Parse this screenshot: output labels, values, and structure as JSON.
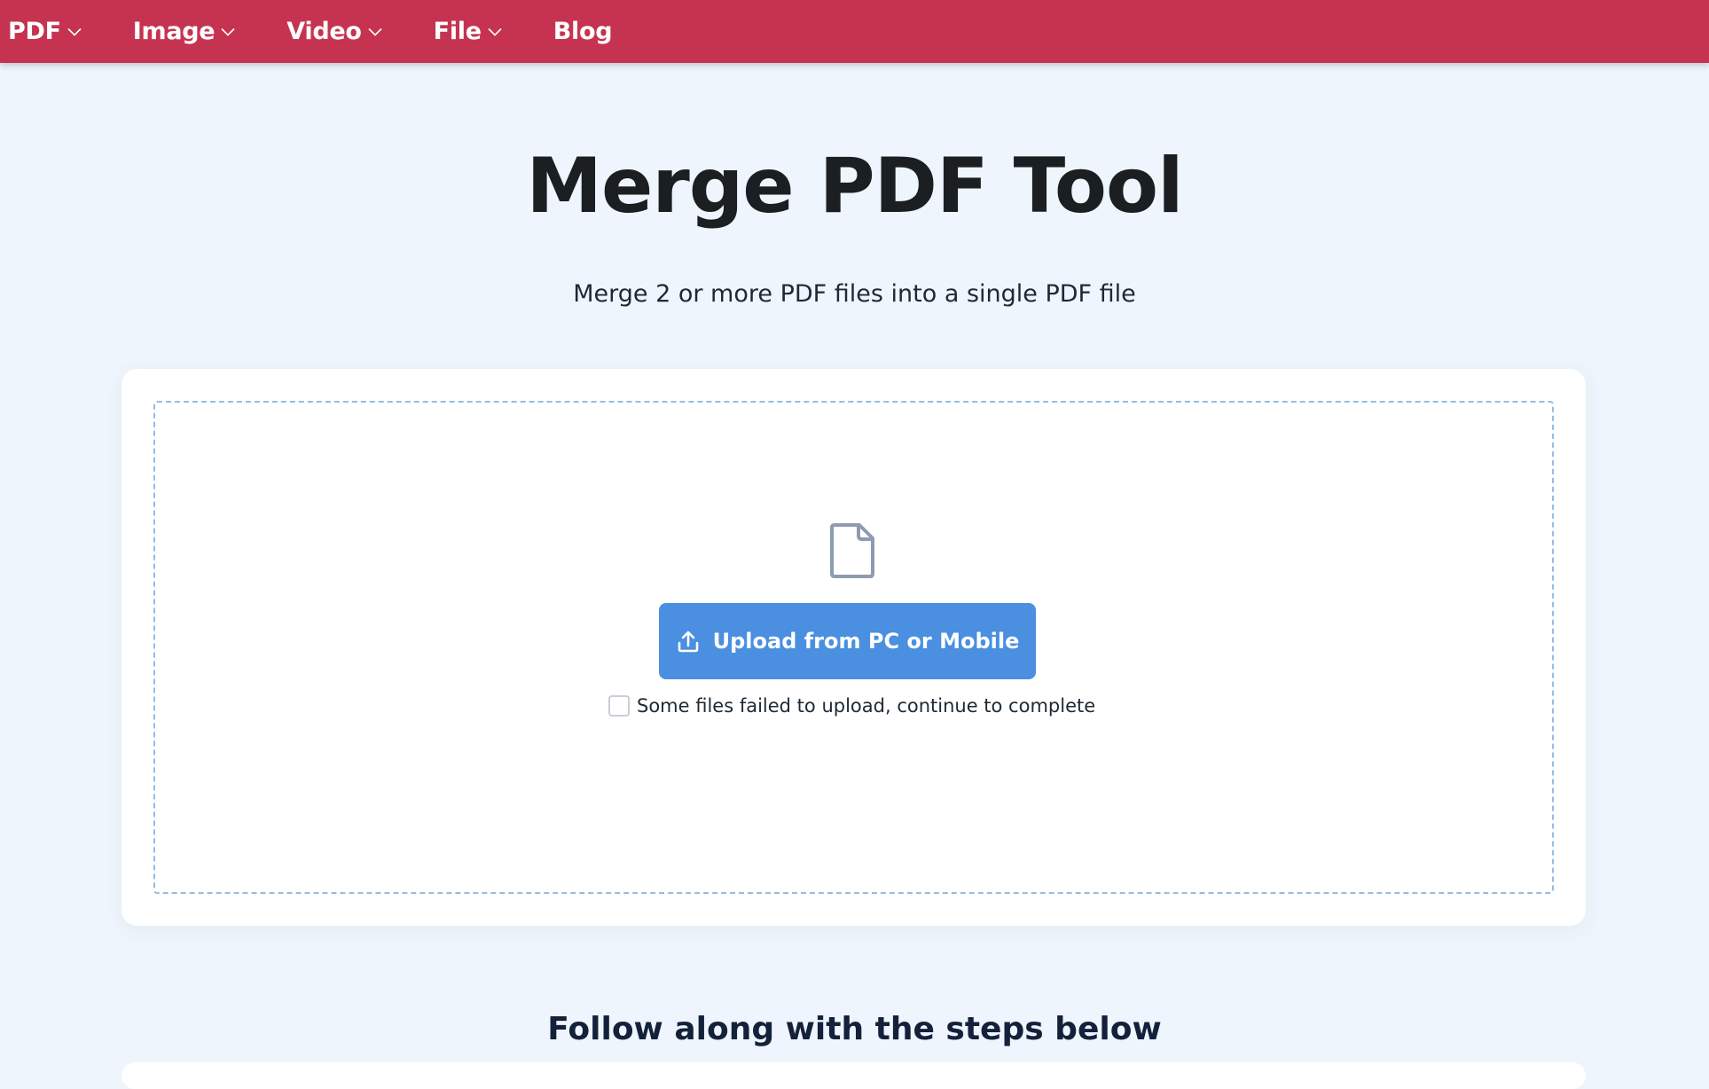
{
  "nav": {
    "items": [
      {
        "label": "PDF",
        "has_dropdown": true
      },
      {
        "label": "Image",
        "has_dropdown": true
      },
      {
        "label": "Video",
        "has_dropdown": true
      },
      {
        "label": "File",
        "has_dropdown": true
      },
      {
        "label": "Blog",
        "has_dropdown": false
      }
    ]
  },
  "main": {
    "title": "Merge PDF Tool",
    "subtitle": "Merge 2 or more PDF files into a single PDF file",
    "upload_button_label": "Upload from PC or Mobile",
    "checkbox_label": "Some files failed to upload, continue to complete",
    "checkbox_checked": false,
    "steps_heading": "Follow along with the steps below"
  },
  "icons": {
    "nav_dropdown": "chevron-down-icon",
    "dropzone": "file-icon",
    "upload": "upload-icon"
  },
  "colors": {
    "nav_background": "#c53350",
    "page_background": "#eef5fc",
    "upload_button": "#4a8fe0",
    "dropzone_border": "#93bde6"
  }
}
